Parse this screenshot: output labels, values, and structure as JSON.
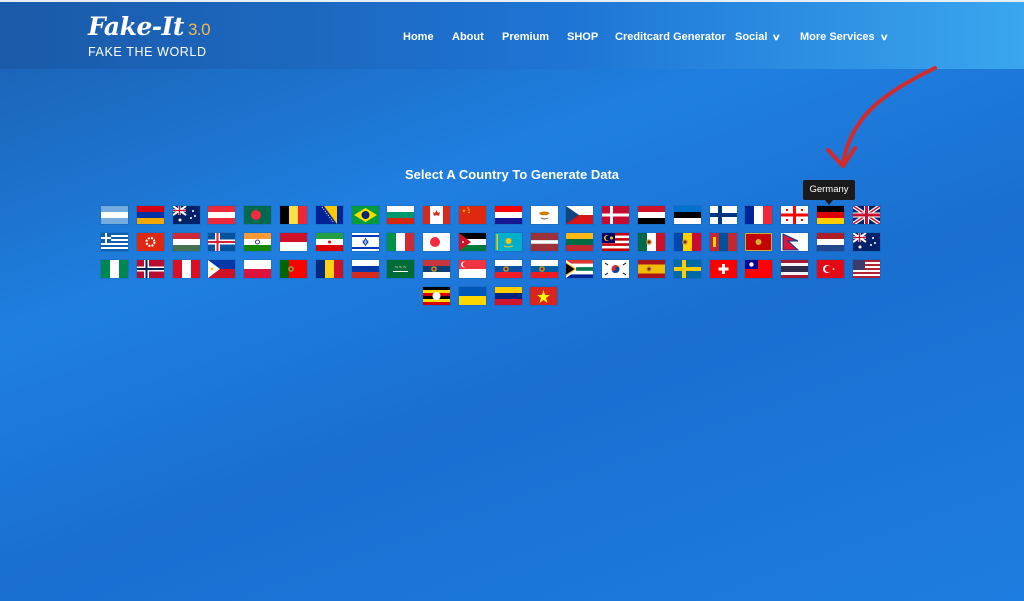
{
  "brand": {
    "name": "Fake-It",
    "version": "3.0",
    "tagline": "FAKE THE WORLD"
  },
  "nav": [
    {
      "label": "Home",
      "has_dropdown": false
    },
    {
      "label": "About",
      "has_dropdown": false
    },
    {
      "label": "Premium",
      "has_dropdown": false
    },
    {
      "label": "SHOP",
      "has_dropdown": false
    },
    {
      "label": "Creditcard Generator",
      "has_dropdown": false
    },
    {
      "label": "Social",
      "has_dropdown": true
    },
    {
      "label": "More Services",
      "has_dropdown": true
    }
  ],
  "heading": "Select A Country To Generate Data",
  "tooltip": "Germany",
  "colors": {
    "annotation_arrow": "#d42a2a",
    "background": "#1f7fe0"
  },
  "flags": [
    "argentina",
    "armenia",
    "australia",
    "austria",
    "bangladesh",
    "belgium",
    "bosnia-herzegovina",
    "brazil",
    "bulgaria",
    "canada",
    "china",
    "croatia",
    "cyprus",
    "czech-republic",
    "denmark",
    "egypt",
    "estonia",
    "finland",
    "france",
    "georgia",
    "germany",
    "united-kingdom",
    "greece",
    "hong-kong",
    "hungary",
    "iceland",
    "india",
    "indonesia",
    "iran",
    "israel",
    "italy",
    "japan",
    "jordan",
    "kazakhstan",
    "latvia",
    "lithuania",
    "malaysia",
    "mexico",
    "moldova",
    "mongolia",
    "montenegro",
    "nepal",
    "netherlands",
    "new-zealand",
    "nigeria",
    "norway",
    "peru",
    "philippines",
    "poland",
    "portugal",
    "romania",
    "russia",
    "saudi-arabia",
    "serbia",
    "singapore",
    "slovakia",
    "slovenia",
    "south-africa",
    "south-korea",
    "spain",
    "sweden",
    "switzerland",
    "taiwan",
    "thailand",
    "turkey",
    "united-states",
    "uganda",
    "ukraine",
    "venezuela",
    "vietnam"
  ]
}
